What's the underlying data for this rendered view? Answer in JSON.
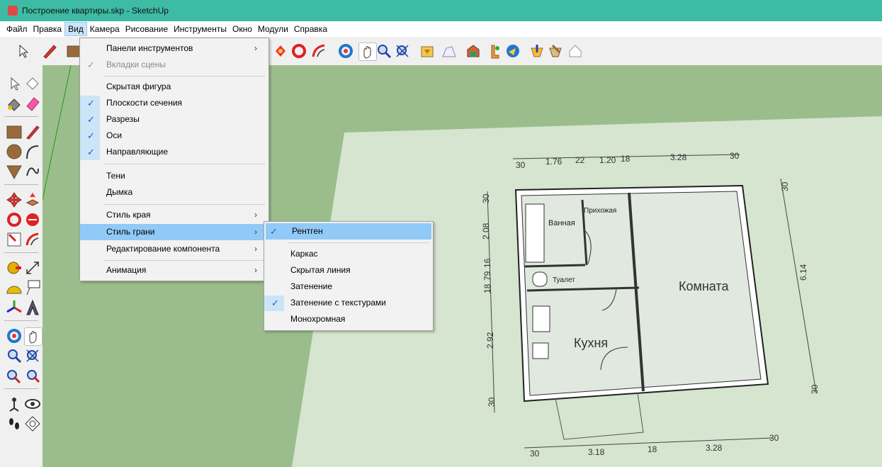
{
  "window": {
    "title": "Построение квартиры.skp - SketchUp"
  },
  "menubar": {
    "items": [
      "Файл",
      "Правка",
      "Вид",
      "Камера",
      "Рисование",
      "Инструменты",
      "Окно",
      "Модули",
      "Справка"
    ]
  },
  "view_menu": {
    "items": [
      {
        "label": "Панели инструментов",
        "checked": false,
        "submenu": true,
        "disabled": false
      },
      {
        "label": "Вкладки сцены",
        "checked": true,
        "submenu": false,
        "disabled": true
      },
      {
        "label": "Скрытая фигура",
        "checked": false,
        "submenu": false,
        "disabled": false
      },
      {
        "label": "Плоскости сечения",
        "checked": true,
        "submenu": false,
        "disabled": false
      },
      {
        "label": "Разрезы",
        "checked": true,
        "submenu": false,
        "disabled": false
      },
      {
        "label": "Оси",
        "checked": true,
        "submenu": false,
        "disabled": false
      },
      {
        "label": "Направляющие",
        "checked": true,
        "submenu": false,
        "disabled": false
      },
      {
        "label": "Тени",
        "checked": false,
        "submenu": false,
        "disabled": false
      },
      {
        "label": "Дымка",
        "checked": false,
        "submenu": false,
        "disabled": false
      },
      {
        "label": "Стиль края",
        "checked": false,
        "submenu": true,
        "disabled": false
      },
      {
        "label": "Стиль грани",
        "checked": false,
        "submenu": true,
        "disabled": false,
        "highlighted": true
      },
      {
        "label": "Редактирование компонента",
        "checked": false,
        "submenu": true,
        "disabled": false
      },
      {
        "label": "Анимация",
        "checked": false,
        "submenu": true,
        "disabled": false
      }
    ]
  },
  "face_style_menu": {
    "items": [
      {
        "label": "Рентген",
        "checked": true,
        "highlighted": true
      },
      {
        "label": "Каркас",
        "checked": false
      },
      {
        "label": "Скрытая линия",
        "checked": false
      },
      {
        "label": "Затенение",
        "checked": false
      },
      {
        "label": "Затенение с текстурами",
        "checked": true
      },
      {
        "label": "Монохромная",
        "checked": false
      }
    ]
  },
  "floor_plan": {
    "rooms": {
      "bath": "Ванная",
      "hall": "Прихожая",
      "toilet": "Туалет",
      "room": "Комната",
      "kitchen": "Кухня"
    },
    "dims_top": [
      "30",
      "1.76",
      "22",
      "1.20",
      "18",
      "3.28",
      "30"
    ],
    "dims_bottom": [
      "30",
      "3.18",
      "18",
      "3.28",
      "30"
    ],
    "dims_left": [
      "30",
      "2.08",
      "16",
      "79",
      "18",
      "2.92",
      "30"
    ],
    "dims_right": [
      "30",
      "6.14",
      "30"
    ]
  },
  "colors": {
    "title_bar": "#3dbba4",
    "ground": "#9bbd8c",
    "highlight": "#91c9f7",
    "plan_bg": "#d5e5cf"
  }
}
